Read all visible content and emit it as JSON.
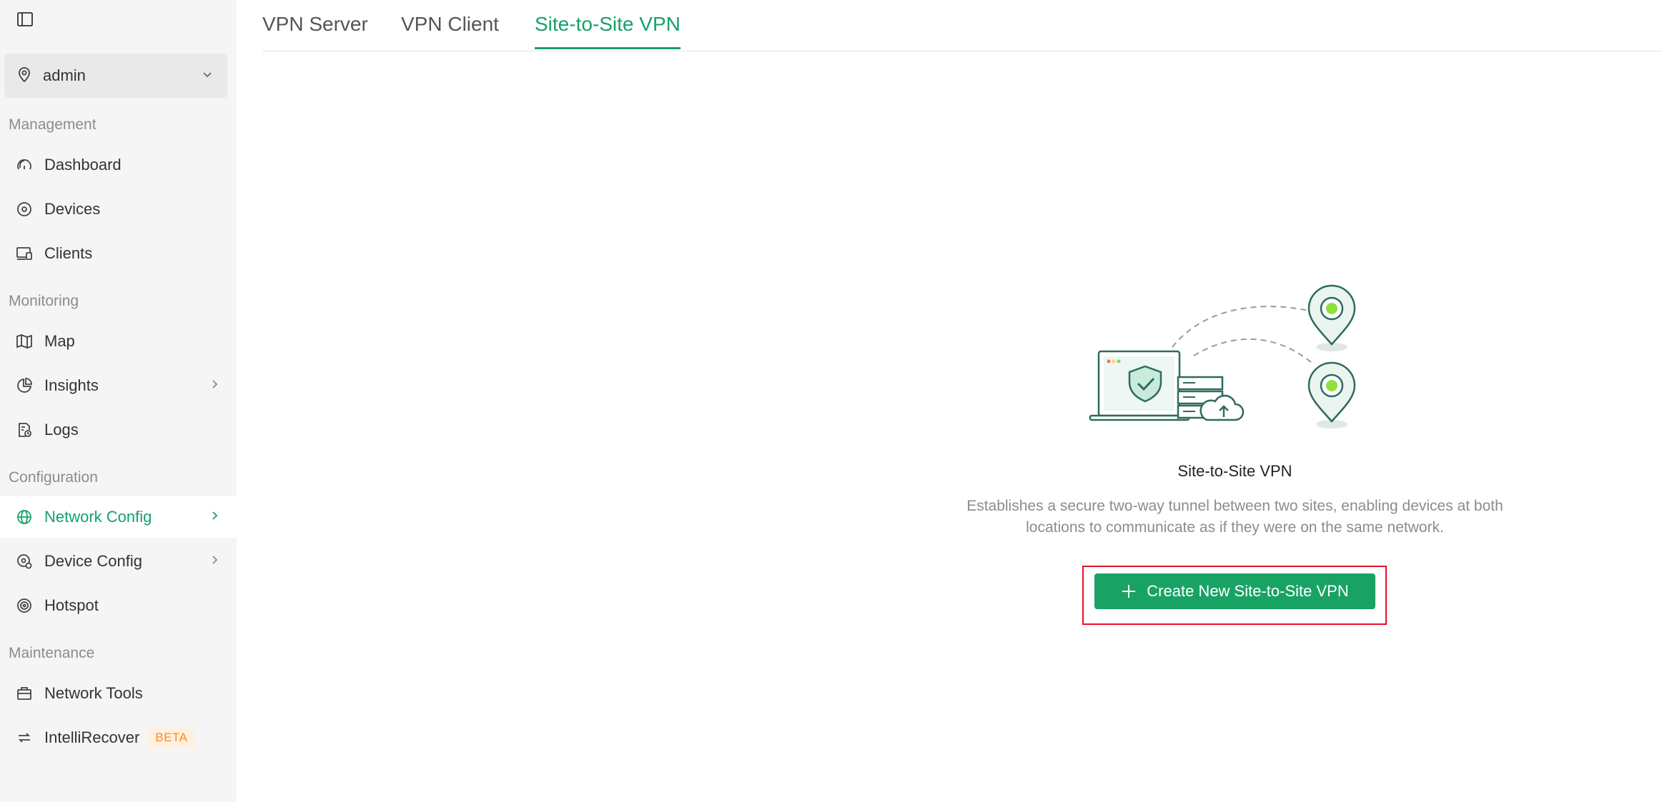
{
  "sidebar": {
    "site": {
      "label": "admin",
      "icon": "location-pin-icon"
    },
    "sections": {
      "management": "Management",
      "monitoring": "Monitoring",
      "configuration": "Configuration",
      "maintenance": "Maintenance"
    },
    "items": {
      "dashboard": "Dashboard",
      "devices": "Devices",
      "clients": "Clients",
      "map": "Map",
      "insights": "Insights",
      "logs": "Logs",
      "network_config": "Network Config",
      "device_config": "Device Config",
      "hotspot": "Hotspot",
      "network_tools": "Network Tools",
      "intellirecover": "IntelliRecover",
      "beta_badge": "BETA"
    },
    "active_item": "Network Config"
  },
  "tabs": [
    {
      "label": "VPN Server"
    },
    {
      "label": "VPN Client"
    },
    {
      "label": "Site-to-Site VPN",
      "active": true
    }
  ],
  "empty_state": {
    "title": "Site-to-Site VPN",
    "description_line1": "Establishes a secure two-way tunnel between two sites, enabling devices at both",
    "description_line2": "locations to communicate as if they were on the same network.",
    "button_label": "Create New Site-to-Site VPN"
  },
  "colors": {
    "accent": "#16a06a",
    "button": "#18a365",
    "highlight": "#e0142b",
    "sidebar_bg": "#f5f5f5"
  }
}
